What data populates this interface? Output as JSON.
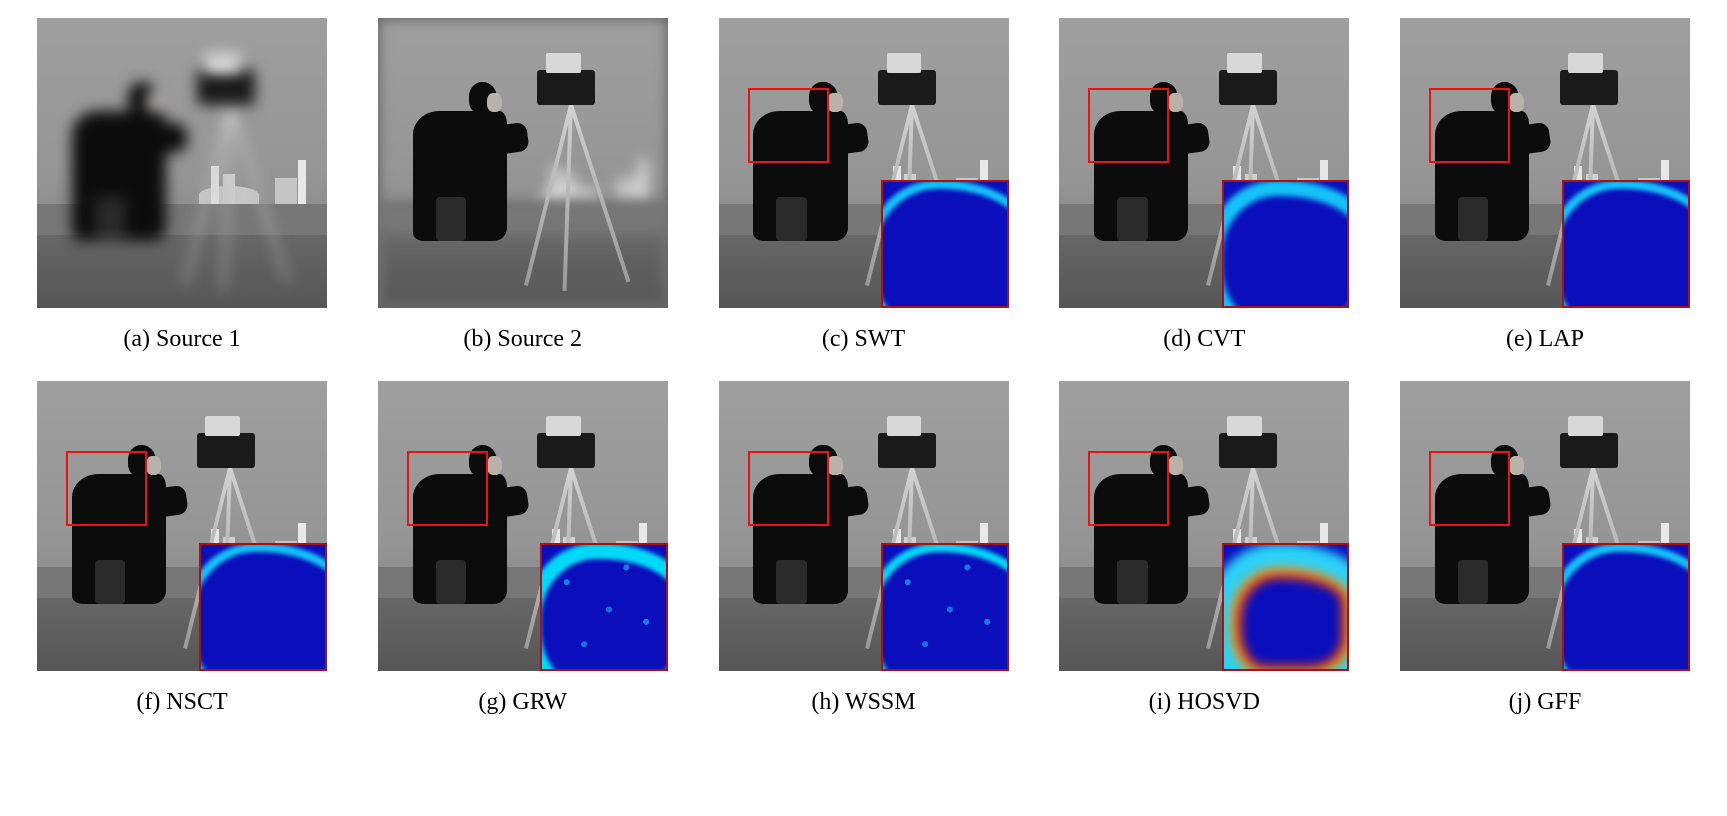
{
  "figure": {
    "columns": 5,
    "rows": 2,
    "roi_color": "#ee1111",
    "inset_border_color": "#aa1111"
  },
  "subfigures": [
    {
      "key": "a",
      "caption": "(a) Source 1",
      "has_roi": false,
      "has_inset": false,
      "blur_mode": "foreground"
    },
    {
      "key": "b",
      "caption": "(b) Source 2",
      "has_roi": false,
      "has_inset": false,
      "blur_mode": "background"
    },
    {
      "key": "c",
      "caption": "(c) SWT",
      "has_roi": true,
      "has_inset": true,
      "inset_style": "thin"
    },
    {
      "key": "d",
      "caption": "(d) CVT",
      "has_roi": true,
      "has_inset": true,
      "inset_style": "medium"
    },
    {
      "key": "e",
      "caption": "(e) LAP",
      "has_roi": true,
      "has_inset": true,
      "inset_style": "thin"
    },
    {
      "key": "f",
      "caption": "(f) NSCT",
      "has_roi": true,
      "has_inset": true,
      "inset_style": "thin"
    },
    {
      "key": "g",
      "caption": "(g) GRW",
      "has_roi": true,
      "has_inset": true,
      "inset_style": "noisy"
    },
    {
      "key": "h",
      "caption": "(h) WSSM",
      "has_roi": true,
      "has_inset": true,
      "inset_style": "noisy"
    },
    {
      "key": "i",
      "caption": "(i) HOSVD",
      "has_roi": true,
      "has_inset": true,
      "inset_style": "hot"
    },
    {
      "key": "j",
      "caption": "(j) GFF",
      "has_roi": true,
      "has_inset": true,
      "inset_style": "thin"
    }
  ]
}
